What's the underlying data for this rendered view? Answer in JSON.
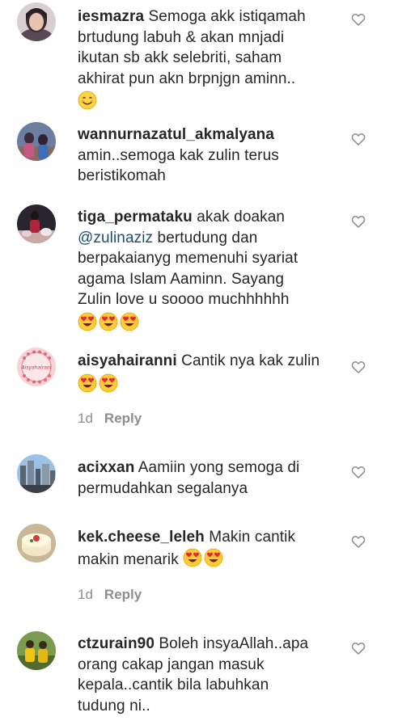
{
  "comments": [
    {
      "username": "iesmazra",
      "lines": [
        "Semoga akk istiqamah",
        "brtudung labuh & akan mnjadi",
        "ikutan sb akk selebriti, saham",
        "akhirat pun akn brpnjgn aminn.."
      ],
      "emoji": [
        "smiling-face"
      ]
    },
    {
      "username": "wannurnazatul_akmalyana",
      "lines": [
        "amin..semoga kak zulin terus",
        "beristikomah"
      ]
    },
    {
      "username": "tiga_permataku",
      "first_text": "akak doakan",
      "mention": "@zulinaziz",
      "mention_rest": "bertudung dan",
      "lines": [
        "berpakaianyg memenuhi syariat",
        "agama Islam Aaminn. Sayang",
        "Zulin love u soooo muchhhhhh"
      ],
      "emoji": [
        "heart-eyes",
        "heart-eyes",
        "heart-eyes"
      ]
    },
    {
      "username": "aisyahairanni",
      "first_text": "Cantik nya kak zulin",
      "emoji": [
        "heart-eyes",
        "heart-eyes"
      ],
      "time": "1d",
      "reply_label": "Reply",
      "avatar_text": "Aisyahairani"
    },
    {
      "username": "acixxan",
      "lines": [
        "Aamiin yong semoga di",
        "permudahkan segalanya"
      ]
    },
    {
      "username": "kek.cheese_leleh",
      "first_text": "Makin cantik",
      "second_text": "makin menarik",
      "emoji": [
        "heart-eyes",
        "heart-eyes"
      ],
      "time": "1d",
      "reply_label": "Reply"
    },
    {
      "username": "ctzurain90",
      "lines": [
        "Boleh insyaAllah..apa",
        "orang cakap jangan masuk",
        "kepala..cantik bila labuhkan",
        "tudung ni.."
      ]
    }
  ],
  "colors": {
    "text": "#262626",
    "muted": "#8e8e8e",
    "mention": "#1e4a72",
    "heart_outline": "#8e8e8e"
  }
}
